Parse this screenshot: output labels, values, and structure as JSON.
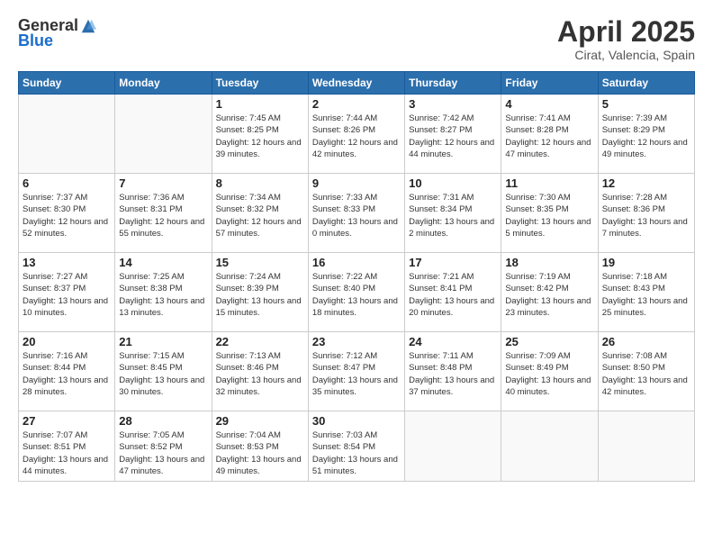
{
  "header": {
    "logo_general": "General",
    "logo_blue": "Blue",
    "title": "April 2025",
    "subtitle": "Cirat, Valencia, Spain"
  },
  "days_of_week": [
    "Sunday",
    "Monday",
    "Tuesday",
    "Wednesday",
    "Thursday",
    "Friday",
    "Saturday"
  ],
  "weeks": [
    [
      {
        "day": "",
        "info": ""
      },
      {
        "day": "",
        "info": ""
      },
      {
        "day": "1",
        "info": "Sunrise: 7:45 AM\nSunset: 8:25 PM\nDaylight: 12 hours and 39 minutes."
      },
      {
        "day": "2",
        "info": "Sunrise: 7:44 AM\nSunset: 8:26 PM\nDaylight: 12 hours and 42 minutes."
      },
      {
        "day": "3",
        "info": "Sunrise: 7:42 AM\nSunset: 8:27 PM\nDaylight: 12 hours and 44 minutes."
      },
      {
        "day": "4",
        "info": "Sunrise: 7:41 AM\nSunset: 8:28 PM\nDaylight: 12 hours and 47 minutes."
      },
      {
        "day": "5",
        "info": "Sunrise: 7:39 AM\nSunset: 8:29 PM\nDaylight: 12 hours and 49 minutes."
      }
    ],
    [
      {
        "day": "6",
        "info": "Sunrise: 7:37 AM\nSunset: 8:30 PM\nDaylight: 12 hours and 52 minutes."
      },
      {
        "day": "7",
        "info": "Sunrise: 7:36 AM\nSunset: 8:31 PM\nDaylight: 12 hours and 55 minutes."
      },
      {
        "day": "8",
        "info": "Sunrise: 7:34 AM\nSunset: 8:32 PM\nDaylight: 12 hours and 57 minutes."
      },
      {
        "day": "9",
        "info": "Sunrise: 7:33 AM\nSunset: 8:33 PM\nDaylight: 13 hours and 0 minutes."
      },
      {
        "day": "10",
        "info": "Sunrise: 7:31 AM\nSunset: 8:34 PM\nDaylight: 13 hours and 2 minutes."
      },
      {
        "day": "11",
        "info": "Sunrise: 7:30 AM\nSunset: 8:35 PM\nDaylight: 13 hours and 5 minutes."
      },
      {
        "day": "12",
        "info": "Sunrise: 7:28 AM\nSunset: 8:36 PM\nDaylight: 13 hours and 7 minutes."
      }
    ],
    [
      {
        "day": "13",
        "info": "Sunrise: 7:27 AM\nSunset: 8:37 PM\nDaylight: 13 hours and 10 minutes."
      },
      {
        "day": "14",
        "info": "Sunrise: 7:25 AM\nSunset: 8:38 PM\nDaylight: 13 hours and 13 minutes."
      },
      {
        "day": "15",
        "info": "Sunrise: 7:24 AM\nSunset: 8:39 PM\nDaylight: 13 hours and 15 minutes."
      },
      {
        "day": "16",
        "info": "Sunrise: 7:22 AM\nSunset: 8:40 PM\nDaylight: 13 hours and 18 minutes."
      },
      {
        "day": "17",
        "info": "Sunrise: 7:21 AM\nSunset: 8:41 PM\nDaylight: 13 hours and 20 minutes."
      },
      {
        "day": "18",
        "info": "Sunrise: 7:19 AM\nSunset: 8:42 PM\nDaylight: 13 hours and 23 minutes."
      },
      {
        "day": "19",
        "info": "Sunrise: 7:18 AM\nSunset: 8:43 PM\nDaylight: 13 hours and 25 minutes."
      }
    ],
    [
      {
        "day": "20",
        "info": "Sunrise: 7:16 AM\nSunset: 8:44 PM\nDaylight: 13 hours and 28 minutes."
      },
      {
        "day": "21",
        "info": "Sunrise: 7:15 AM\nSunset: 8:45 PM\nDaylight: 13 hours and 30 minutes."
      },
      {
        "day": "22",
        "info": "Sunrise: 7:13 AM\nSunset: 8:46 PM\nDaylight: 13 hours and 32 minutes."
      },
      {
        "day": "23",
        "info": "Sunrise: 7:12 AM\nSunset: 8:47 PM\nDaylight: 13 hours and 35 minutes."
      },
      {
        "day": "24",
        "info": "Sunrise: 7:11 AM\nSunset: 8:48 PM\nDaylight: 13 hours and 37 minutes."
      },
      {
        "day": "25",
        "info": "Sunrise: 7:09 AM\nSunset: 8:49 PM\nDaylight: 13 hours and 40 minutes."
      },
      {
        "day": "26",
        "info": "Sunrise: 7:08 AM\nSunset: 8:50 PM\nDaylight: 13 hours and 42 minutes."
      }
    ],
    [
      {
        "day": "27",
        "info": "Sunrise: 7:07 AM\nSunset: 8:51 PM\nDaylight: 13 hours and 44 minutes."
      },
      {
        "day": "28",
        "info": "Sunrise: 7:05 AM\nSunset: 8:52 PM\nDaylight: 13 hours and 47 minutes."
      },
      {
        "day": "29",
        "info": "Sunrise: 7:04 AM\nSunset: 8:53 PM\nDaylight: 13 hours and 49 minutes."
      },
      {
        "day": "30",
        "info": "Sunrise: 7:03 AM\nSunset: 8:54 PM\nDaylight: 13 hours and 51 minutes."
      },
      {
        "day": "",
        "info": ""
      },
      {
        "day": "",
        "info": ""
      },
      {
        "day": "",
        "info": ""
      }
    ]
  ]
}
